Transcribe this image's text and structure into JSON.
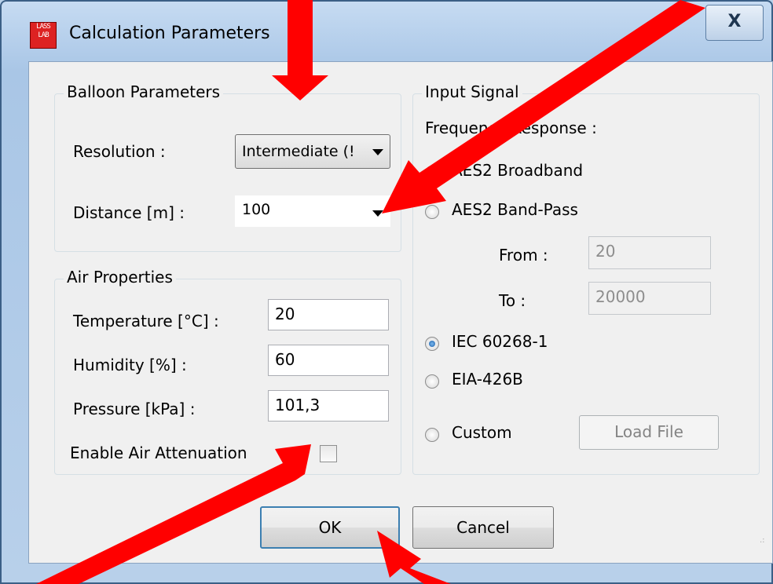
{
  "window": {
    "title": "Calculation Parameters",
    "close_label": "X",
    "icon_text": "LASS\nLAB"
  },
  "balloon": {
    "group_title": "Balloon Parameters",
    "resolution_label": "Resolution :",
    "resolution_value": "Intermediate (!",
    "distance_label": "Distance [m] :",
    "distance_value": "100"
  },
  "air": {
    "group_title": "Air Properties",
    "temperature_label": "Temperature [°C] :",
    "temperature_value": "20",
    "humidity_label": "Humidity [%] :",
    "humidity_value": "60",
    "pressure_label": "Pressure [kPa] :",
    "pressure_value": "101,3",
    "attenuation_label": "Enable Air Attenuation",
    "attenuation_checked": false
  },
  "input_signal": {
    "group_title": "Input Signal",
    "freq_response_label": "Frequency Response :",
    "options": [
      {
        "label": "AES2 Broadband",
        "checked": false
      },
      {
        "label": "AES2 Band-Pass",
        "checked": false
      },
      {
        "label": "IEC 60268-1",
        "checked": true
      },
      {
        "label": "EIA-426B",
        "checked": false
      },
      {
        "label": "Custom",
        "checked": false
      }
    ],
    "from_label": "From :",
    "from_value": "20",
    "to_label": "To :",
    "to_value": "20000",
    "load_file_label": "Load File"
  },
  "buttons": {
    "ok_label": "OK",
    "cancel_label": "Cancel"
  },
  "colors": {
    "annotation_arrow": "#ff0000",
    "title_bar": "#b9d1ea",
    "dialog_bg": "#f0f0f0"
  }
}
